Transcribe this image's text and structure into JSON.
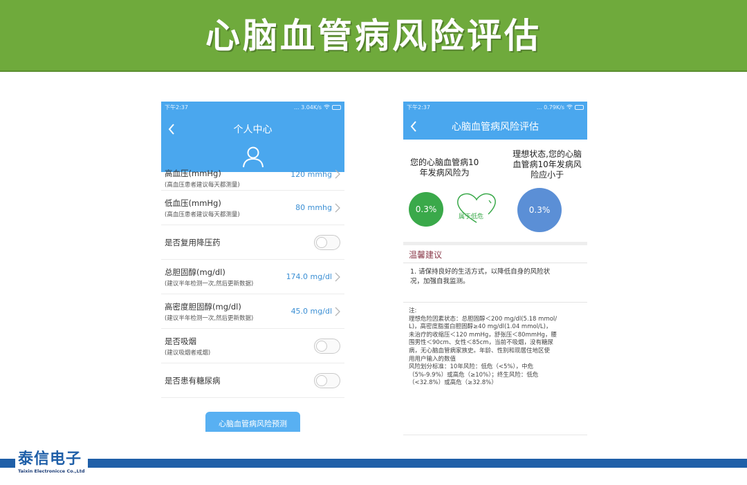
{
  "slide": {
    "title": "心脑血管病风险评估"
  },
  "left_phone": {
    "status_time": "下午2:37",
    "status_right": "... 3.04K/s",
    "page_title": "个人中心",
    "rows": [
      {
        "label": "高血压(mmHg)",
        "sub": "(高血压患者建议每天都测量)",
        "value": "120 mmhg"
      },
      {
        "label": "低血压(mmHg)",
        "sub": "(高血压患者建议每天都测量)",
        "value": "80 mmhg"
      },
      {
        "label": "是否复用降压药"
      },
      {
        "label": "总胆固醇(mg/dl)",
        "sub": "(建议半年检测一次,然后更新数据)",
        "value": "174.0 mg/dl"
      },
      {
        "label": "高密度胆固醇(mg/dl)",
        "sub": "(建议半年检测一次,然后更新数据)",
        "value": "45.0 mg/dl"
      },
      {
        "label": "是否吸烟",
        "sub": "(建议吸烟者戒烟)"
      },
      {
        "label": "是否患有糖尿病"
      }
    ],
    "cta_label": "心脑血管病风险预测"
  },
  "right_phone": {
    "status_time": "下午2:37",
    "status_right": "... 0.79K/s",
    "page_title": "心脑血管病风险评估",
    "your_risk_lines": [
      "您的心脑血管病10",
      "年发病风险为"
    ],
    "ideal_lines": [
      "理想状态,您的心脑",
      "血管病10年发病风",
      "险应小于"
    ],
    "your_risk_value": "0.3%",
    "risk_level": "属于低危",
    "ideal_value": "0.3%",
    "tips_title": "温馨建议",
    "tips_lines": [
      "1. 请保持良好的生活方式，以降低自身的风险状",
      "况，加强自我监测。"
    ],
    "notes_lines": [
      "注:",
      "理想危险因素状态：总胆固醇＜200 mg/dl(5.18 mmol/",
      "L)，高密度脂蛋白胆固醇≥40 mg/dl(1.04 mmol/L)，",
      "未治疗的收缩压＜120 mmHg，舒张压＜80mmHg，腰",
      "围男性＜90cm、女性＜85cm，当前不吸烟，没有糖尿",
      "病，无心脑血管病家族史。年龄、性别和现居住地区使",
      "用用户输入的数值",
      "风险划分标准：10年风险：低危（<5%），中危",
      "（5%-9.9%）或高危（≥10%）；终生风险：低危",
      "（<32.8%）或高危（≥32.8%）"
    ]
  },
  "footer": {
    "logo_cn": "泰信电子",
    "logo_en": "Taixin Electronicce Co.,Ltd"
  },
  "colors": {
    "banner": "#6faa3c",
    "app_blue": "#4aa7ee",
    "value_blue": "#3b8fd4",
    "risk_green": "#3aa94a",
    "ideal_blue": "#5b8fd6",
    "footer_blue": "#1f5fa8"
  }
}
